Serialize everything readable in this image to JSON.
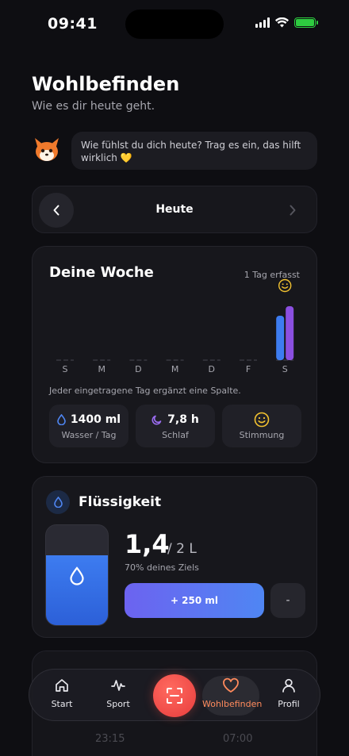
{
  "status_bar": {
    "time": "09:41"
  },
  "header": {
    "title": "Wohlbefinden",
    "subtitle": "Wie es dir heute geht."
  },
  "mascot": {
    "icon": "fox-mascot-icon",
    "message": "Wie fühlst du dich heute? Trag es ein, das hilft wirklich 💛"
  },
  "day_selector": {
    "label": "Heute"
  },
  "week": {
    "title": "Deine Woche",
    "count_label": "1 Tag erfasst",
    "days": [
      "S",
      "M",
      "D",
      "M",
      "D",
      "F",
      "S"
    ],
    "note": "Jeder eingetragene Tag ergänzt eine Spalte.",
    "chart_data": {
      "type": "bar",
      "categories": [
        "S",
        "M",
        "D",
        "M",
        "D",
        "F",
        "S"
      ],
      "series": [
        {
          "values": [
            0,
            0,
            0,
            0,
            0,
            0,
            0.7
          ]
        },
        {
          "values": [
            0,
            0,
            0,
            0,
            0,
            0,
            0.85
          ]
        }
      ],
      "mood_marker_day": 6
    },
    "stats": [
      {
        "icon": "water-drop-icon",
        "value": "1400 ml",
        "label": "Wasser / Tag"
      },
      {
        "icon": "moon-icon",
        "value": "7,8 h",
        "label": "Schlaf"
      },
      {
        "icon": "smile-icon",
        "value": "",
        "label": "Stimmung"
      }
    ]
  },
  "fluid": {
    "title": "Flüssigkeit",
    "amount": "1,4",
    "goal": "/ 2 L",
    "percent_label": "70% deines Ziels",
    "fill_fraction": 0.7,
    "add_label": "+ 250 ml",
    "minus_label": "-"
  },
  "faded": {
    "time_a": "23:15",
    "time_b": "07:00"
  },
  "tabbar": {
    "tabs": [
      {
        "label": "Start",
        "icon": "home-icon"
      },
      {
        "label": "Sport",
        "icon": "activity-icon"
      },
      {
        "label": "Wohlbefinden",
        "icon": "heart-icon"
      },
      {
        "label": "Profil",
        "icon": "user-icon"
      }
    ],
    "scan_icon": "scan-icon"
  },
  "colors": {
    "accent_blue": "#3d7cf0",
    "accent_purple": "#8b4fe0",
    "active_tab": "#ff8a5c",
    "scan_red": "#e83c3c"
  }
}
